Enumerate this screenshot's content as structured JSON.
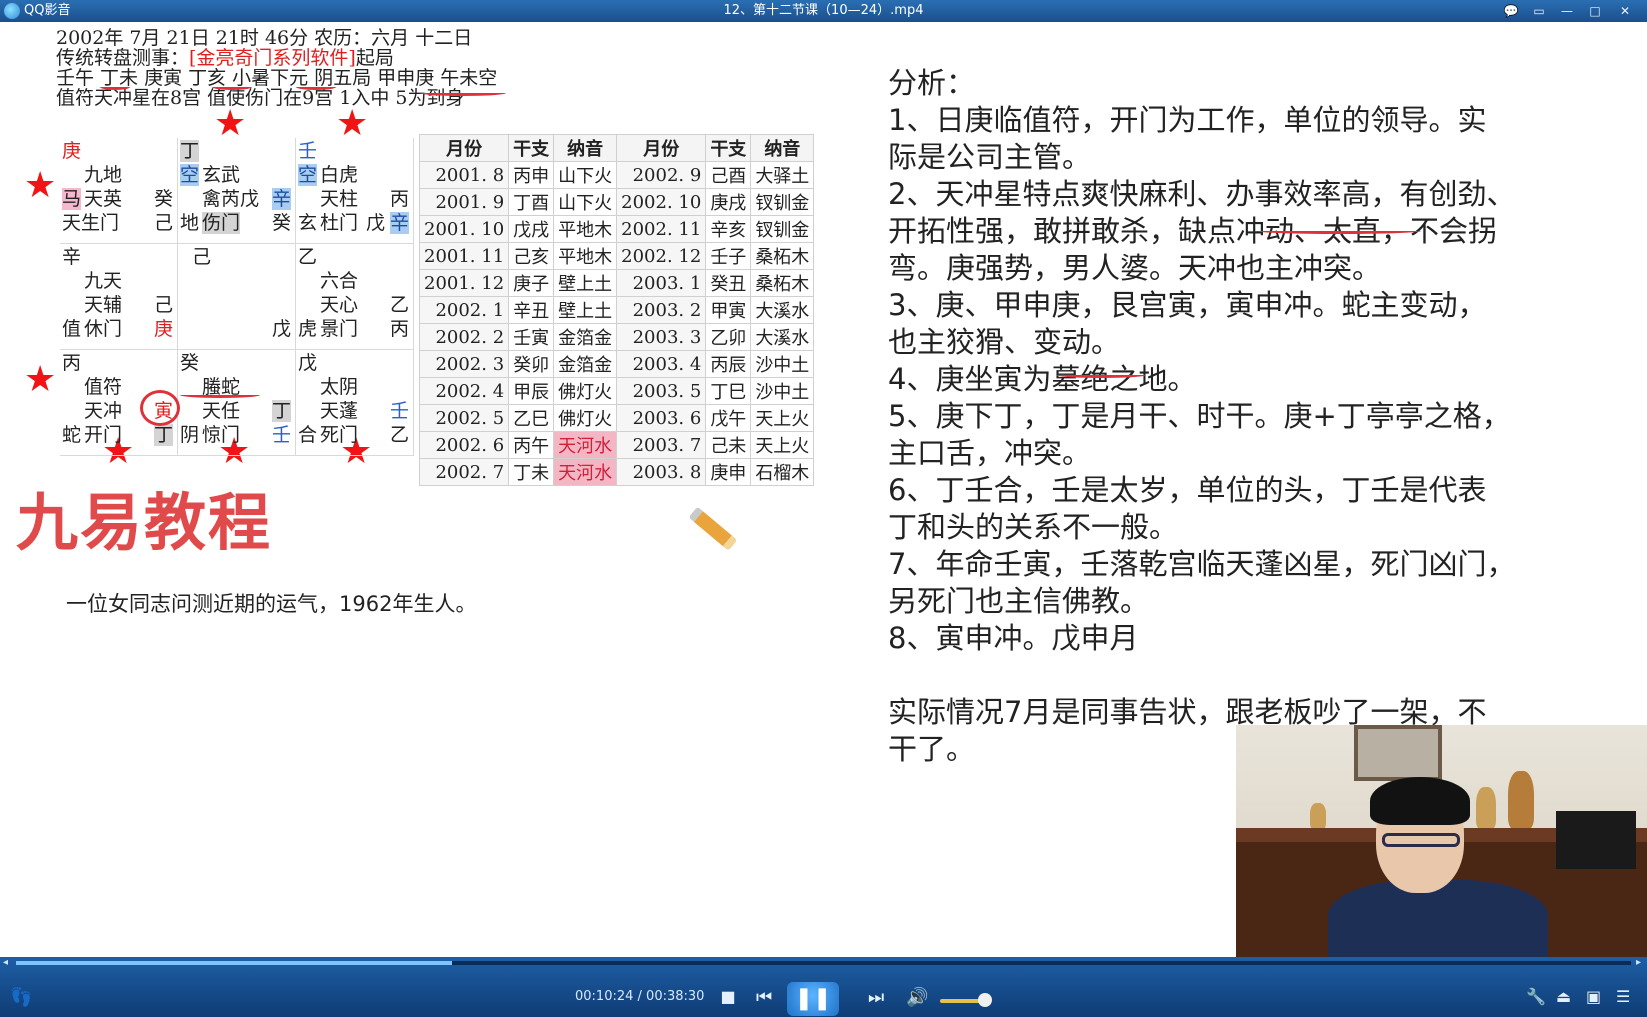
{
  "titlebar": {
    "app_name": "QQ影音",
    "file_name": "12、第十二节课（10—24）.mp4",
    "controls": [
      "feedback-icon",
      "mini-mode-icon",
      "minimize-icon",
      "maximize-icon",
      "close-icon"
    ]
  },
  "chart_header": {
    "line1": "2002年  7月  21日   21时  46分  农历：六月  十二日",
    "line2_prefix": "传统转盘测事：",
    "line2_software": "[金亮奇门系列软件]",
    "line2_suffix": "起局",
    "line3": "壬午  丁未  庚寅  丁亥  小暑下元  阴五局  甲申庚  午未空",
    "line4": "值符天冲星在8宫  值使伤门在9宫  1入中  5为到身"
  },
  "palaces": [
    {
      "id": "top-left",
      "lines": [
        {
          "t": "庚",
          "cls": "txt-red"
        },
        {
          "t": "九地"
        },
        {
          "t": "马",
          "cls": "hl-pink"
        },
        {
          "t": "天英"
        },
        {
          "t": "癸"
        },
        {
          "t": "天生门"
        },
        {
          "t": "己"
        }
      ]
    },
    {
      "id": "top-mid",
      "lines": [
        {
          "t": "丁",
          "cls": "hl-gray"
        },
        {
          "t": "空",
          "cls": "hl-blue"
        },
        {
          "t": "玄武"
        },
        {
          "t": "禽芮戊"
        },
        {
          "t": "辛",
          "cls": "hl-blue"
        },
        {
          "t": "地"
        },
        {
          "t": "伤门",
          "cls": "hl-gray"
        },
        {
          "t": "癸"
        }
      ]
    },
    {
      "id": "top-right",
      "lines": [
        {
          "t": "壬",
          "cls": "txt-blue"
        },
        {
          "t": "空",
          "cls": "hl-blue"
        },
        {
          "t": "白虎"
        },
        {
          "t": "天柱"
        },
        {
          "t": "丙"
        },
        {
          "t": "玄"
        },
        {
          "t": "杜门"
        },
        {
          "t": "戊"
        },
        {
          "t": "辛",
          "cls": "hl-blue"
        }
      ]
    },
    {
      "id": "mid-left",
      "lines": [
        {
          "t": "辛"
        },
        {
          "t": "九天"
        },
        {
          "t": "天辅"
        },
        {
          "t": "己"
        },
        {
          "t": "值"
        },
        {
          "t": "休门"
        },
        {
          "t": "庚",
          "cls": "txt-red"
        }
      ]
    },
    {
      "id": "center",
      "lines": [
        {
          "t": "己"
        },
        {
          "t": "戊"
        }
      ]
    },
    {
      "id": "mid-right",
      "lines": [
        {
          "t": "乙"
        },
        {
          "t": "六合"
        },
        {
          "t": "天心"
        },
        {
          "t": "乙"
        },
        {
          "t": "虎"
        },
        {
          "t": "景门"
        },
        {
          "t": "丙"
        }
      ]
    },
    {
      "id": "bottom-left",
      "lines": [
        {
          "t": "丙"
        },
        {
          "t": "值符"
        },
        {
          "t": "天冲"
        },
        {
          "t": "寅",
          "cls": "txt-red"
        },
        {
          "t": "蛇"
        },
        {
          "t": "开门"
        },
        {
          "t": "丁",
          "cls": "hl-gray"
        }
      ]
    },
    {
      "id": "bottom-mid",
      "lines": [
        {
          "t": "癸"
        },
        {
          "t": "螣蛇"
        },
        {
          "t": "天任"
        },
        {
          "t": "丁",
          "cls": "hl-gray"
        },
        {
          "t": "阴"
        },
        {
          "t": "惊门"
        },
        {
          "t": "壬",
          "cls": "txt-blue"
        }
      ]
    },
    {
      "id": "bottom-right",
      "lines": [
        {
          "t": "戊"
        },
        {
          "t": "太阴"
        },
        {
          "t": "天蓬"
        },
        {
          "t": "壬",
          "cls": "txt-blue"
        },
        {
          "t": "合"
        },
        {
          "t": "死门"
        },
        {
          "t": "乙"
        }
      ]
    }
  ],
  "nayin_table": {
    "headers": [
      "月份",
      "干支",
      "纳音",
      "月份",
      "干支",
      "纳音"
    ],
    "rows": [
      [
        "2001. 8",
        "丙申",
        "山下火",
        "2002. 9",
        "己酉",
        "大驿土"
      ],
      [
        "2001. 9",
        "丁酉",
        "山下火",
        "2002. 10",
        "庚戌",
        "钗钏金"
      ],
      [
        "2001. 10",
        "戊戌",
        "平地木",
        "2002. 11",
        "辛亥",
        "钗钏金"
      ],
      [
        "2001. 11",
        "己亥",
        "平地木",
        "2002. 12",
        "壬子",
        "桑柘木"
      ],
      [
        "2001. 12",
        "庚子",
        "壁上土",
        "2003. 1",
        "癸丑",
        "桑柘木"
      ],
      [
        "2002. 1",
        "辛丑",
        "壁上土",
        "2003. 2",
        "甲寅",
        "大溪水"
      ],
      [
        "2002. 2",
        "壬寅",
        "金箔金",
        "2003. 3",
        "乙卯",
        "大溪水"
      ],
      [
        "2002. 3",
        "癸卯",
        "金箔金",
        "2003. 4",
        "丙辰",
        "沙中土"
      ],
      [
        "2002. 4",
        "甲辰",
        "佛灯火",
        "2003. 5",
        "丁巳",
        "沙中土"
      ],
      [
        "2002. 5",
        "乙巳",
        "佛灯火",
        "2003. 6",
        "戊午",
        "天上火"
      ],
      [
        "2002. 6",
        "丙午",
        "天河水",
        "2003. 7",
        "己未",
        "天上火"
      ],
      [
        "2002. 7",
        "丁未",
        "天河水",
        "2003. 8",
        "庚申",
        "石榴木"
      ]
    ],
    "highlight_rows": [
      10,
      11
    ]
  },
  "brand": "九易教程",
  "question": "一位女同志问测近期的运气，1962年生人。",
  "analysis": [
    "分析：",
    "1、日庚临值符，开门为工作，单位的领导。实",
    "际是公司主管。",
    "2、天冲星特点爽快麻利、办事效率高，有创劲、",
    "开拓性强，敢拼敢杀，缺点冲动、太直，不会拐",
    "弯。庚强势，男人婆。天冲也主冲突。",
    "3、庚、甲申庚，艮宫寅，寅申冲。蛇主变动，",
    "也主狡猾、变动。",
    "4、庚坐寅为墓绝之地。",
    "5、庚下丁，丁是月干、时干。庚+丁亭亭之格，",
    "主口舌，冲突。",
    "6、丁壬合，壬是太岁，单位的头，丁壬是代表",
    "丁和头的关系不一般。",
    "7、年命壬寅，壬落乾宫临天蓬凶星，死门凶门，",
    "另死门也主信佛教。",
    "8、寅申冲。戊申月",
    "",
    "实际情况7月是同事告状，跟老板吵了一架，不",
    "干了。"
  ],
  "player": {
    "current_time": "00:10:24",
    "total_time": "00:38:30",
    "progress": 0.27,
    "volume": 0.8,
    "controls": [
      "footprint-icon",
      "stop-icon",
      "prev-icon",
      "pause-icon",
      "next-icon",
      "volume-icon",
      "wrench-icon",
      "eject-icon",
      "screenshot-icon",
      "playlist-icon"
    ],
    "colors": {
      "bar": "#1b5aa0",
      "progress": "#7ec4ff",
      "title": "#2a6fb3"
    }
  }
}
